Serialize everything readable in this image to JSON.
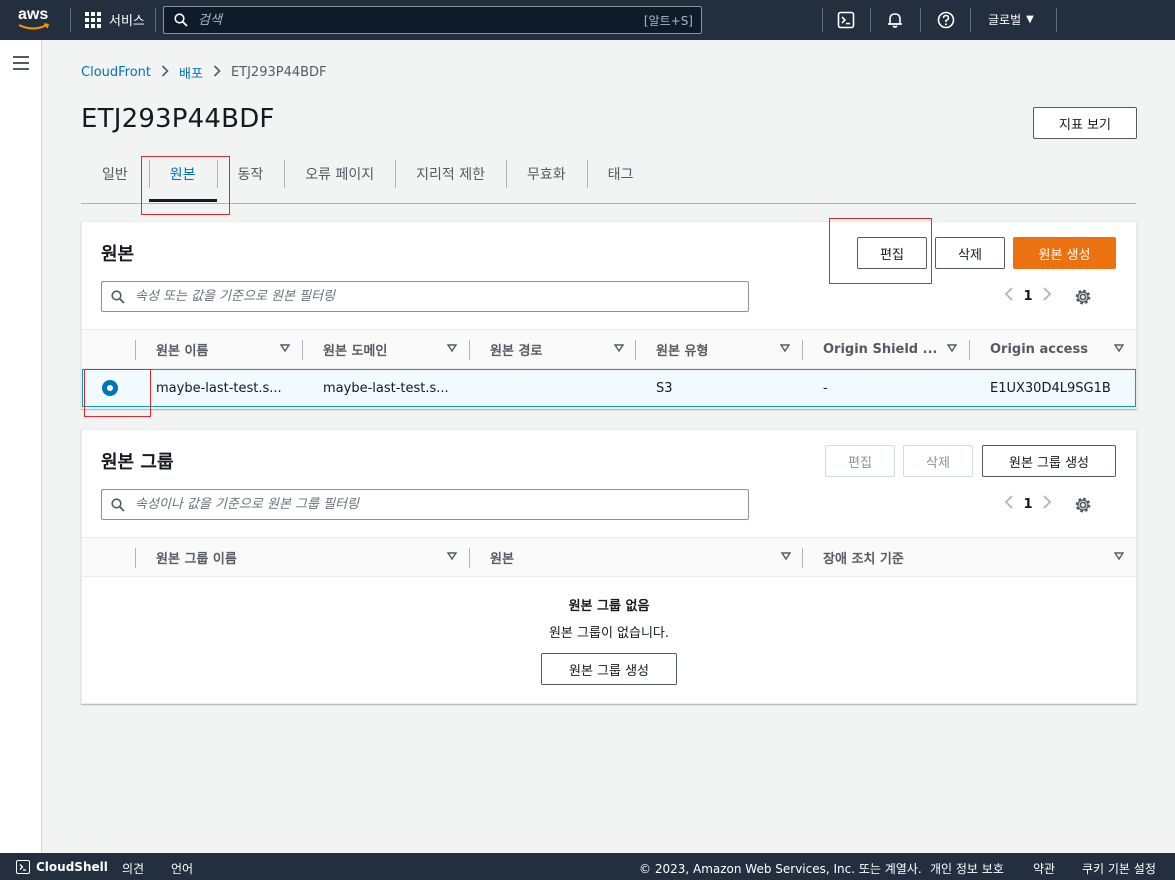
{
  "topnav": {
    "logo_text": "aws",
    "services_label": "서비스",
    "search_placeholder": "검색",
    "search_shortcut": "[알트+S]",
    "region_label": "글로벌"
  },
  "breadcrumb": {
    "root": "CloudFront",
    "parent": "배포",
    "current": "ETJ293P44BDF"
  },
  "page": {
    "title": "ETJ293P44BDF",
    "metrics_button": "지표 보기"
  },
  "tabs": [
    {
      "label": "일반"
    },
    {
      "label": "원본"
    },
    {
      "label": "동작"
    },
    {
      "label": "오류 페이지"
    },
    {
      "label": "지리적 제한"
    },
    {
      "label": "무효화"
    },
    {
      "label": "태그"
    }
  ],
  "origins": {
    "title": "원본",
    "edit_label": "편집",
    "delete_label": "삭제",
    "create_label": "원본 생성",
    "filter_placeholder": "속성 또는 값을 기준으로 원본 필터링",
    "page": "1",
    "columns": [
      "원본 이름",
      "원본 도메인",
      "원본 경로",
      "원본 유형",
      "Origin Shield ...",
      "Origin access"
    ],
    "row": {
      "name": "maybe-last-test.s...",
      "domain": "maybe-last-test.s...",
      "path": "",
      "type": "S3",
      "shield": "-",
      "access": "E1UX30D4L9SG1B"
    }
  },
  "origin_groups": {
    "title": "원본 그룹",
    "edit_label": "편집",
    "delete_label": "삭제",
    "create_label": "원본 그룹 생성",
    "filter_placeholder": "속성이나 값을 기준으로 원본 그룹 필터링",
    "page": "1",
    "columns": [
      "원본 그룹 이름",
      "원본",
      "장애 조치 기준"
    ],
    "empty_title": "원본 그룹 없음",
    "empty_desc": "원본 그룹이 없습니다.",
    "empty_create": "원본 그룹 생성"
  },
  "footer": {
    "cloudshell": "CloudShell",
    "feedback": "의견",
    "language": "언어",
    "copyright": "© 2023, Amazon Web Services, Inc. 또는 계열사.",
    "privacy": "개인 정보 보호",
    "terms": "약관",
    "cookies": "쿠키 기본 설정"
  },
  "colors": {
    "nav_bg": "#232f3e",
    "link": "#0073bb",
    "primary": "#ec7211",
    "highlight": "#e7262a"
  }
}
